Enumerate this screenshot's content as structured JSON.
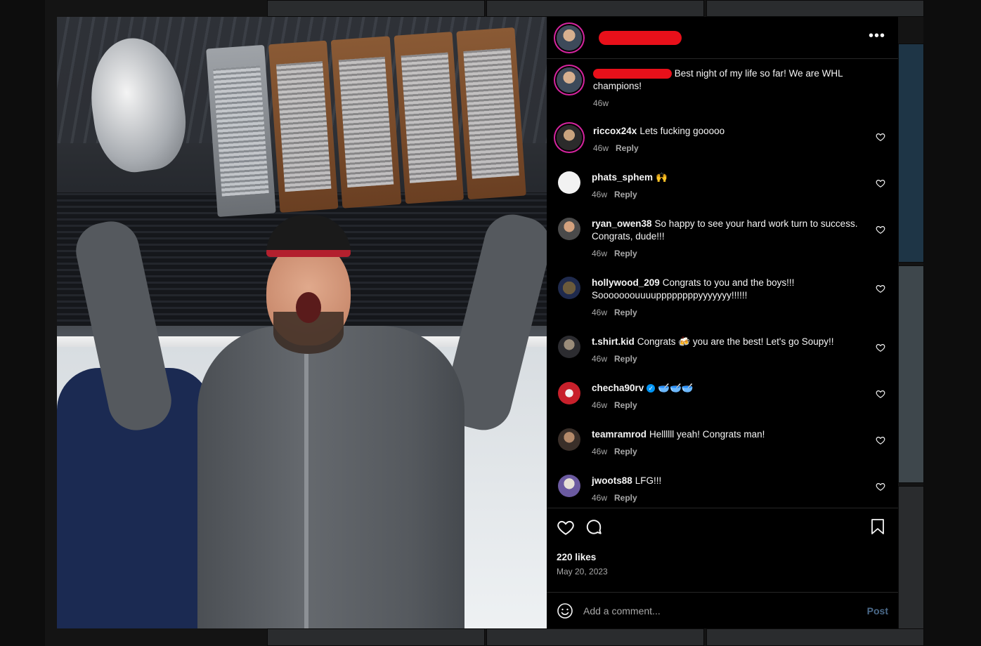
{
  "post": {
    "more_icon": "more-horizontal-icon",
    "caption": {
      "text": "Best night of my life so far! We are WHL champions!",
      "time": "46w"
    },
    "comments": [
      {
        "user": "riccox24x",
        "text": "Lets fucking gooooo",
        "time": "46w",
        "reply": "Reply",
        "verified": false
      },
      {
        "user": "phats_sphem",
        "text": "🙌",
        "time": "46w",
        "reply": "Reply",
        "verified": false
      },
      {
        "user": "ryan_owen38",
        "text": "So happy to see your hard work turn to success. Congrats, dude!!!",
        "time": "46w",
        "reply": "Reply",
        "verified": false
      },
      {
        "user": "hollywood_209",
        "text": "Congrats to you and the boys!!! Sooooooouuuuppppppppyyyyyyy!!!!!!",
        "time": "46w",
        "reply": "Reply",
        "verified": false
      },
      {
        "user": "t.shirt.kid",
        "text": "Congrats 🍻 you are the best! Let's go Soupy!!",
        "time": "46w",
        "reply": "Reply",
        "verified": false
      },
      {
        "user": "checha90rv",
        "text": "🥣🥣🥣",
        "time": "46w",
        "reply": "Reply",
        "verified": true
      },
      {
        "user": "teamramrod",
        "text": "Hellllll yeah! Congrats man!",
        "time": "46w",
        "reply": "Reply",
        "verified": false
      },
      {
        "user": "jwoots88",
        "text": "LFG!!!",
        "time": "46w",
        "reply": "Reply",
        "verified": false
      }
    ],
    "likes": "220 likes",
    "date": "May 20, 2023",
    "add_comment_placeholder": "Add a comment...",
    "post_label": "Post",
    "icons": {
      "like": "heart-icon",
      "comment": "comment-bubble-icon",
      "save": "bookmark-icon",
      "emoji": "emoji-smile-icon"
    }
  },
  "colors": {
    "redaction": "#e8101a",
    "avatar_ring": "#d6249f",
    "verified": "#0095f6",
    "post_button": "#4b6a8a"
  }
}
